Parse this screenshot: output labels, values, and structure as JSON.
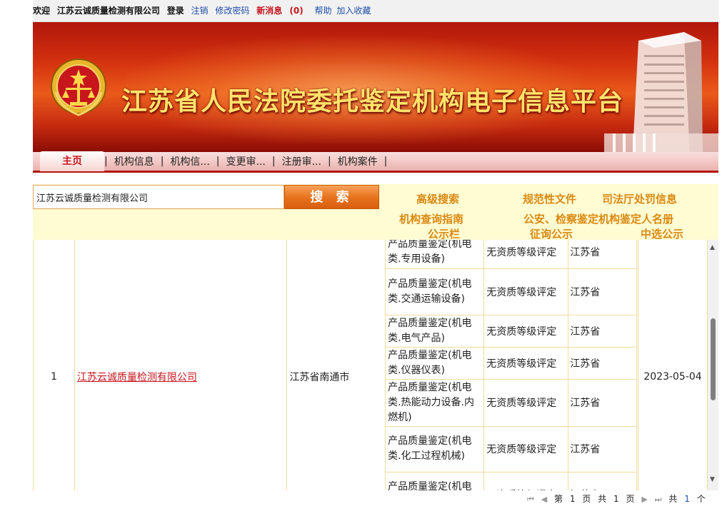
{
  "topbar": {
    "welcome": "欢迎",
    "company": "江苏云诚质量检测有限公司",
    "login": "登录",
    "logout": "注销",
    "change_password": "修改密码",
    "new_messages": "新消息",
    "message_count": "(0)",
    "help": "帮助",
    "favorite": "加入收藏"
  },
  "banner": {
    "title": "江苏省人民法院委托鉴定机构电子信息平台"
  },
  "nav": {
    "items": [
      "主页",
      "机构信息",
      "机构信...",
      "变更审...",
      "注册审...",
      "机构案件"
    ],
    "separator": "|"
  },
  "search": {
    "value": "江苏云诚质量检测有限公司",
    "button": "搜 索",
    "links": {
      "advanced": "高级搜索",
      "normative": "规范性文件",
      "penalty": "司法厅处罚信息",
      "guide": "机构查询指南",
      "roster": "公安、检察鉴定机构鉴定人名册",
      "bulletin": "公示栏",
      "solicit": "征询公示",
      "selected": "中选公示"
    }
  },
  "table": {
    "index": "1",
    "company": "江苏云诚质量检测有限公司",
    "city": "江苏省南通市",
    "date": "2023-05-04",
    "rows": [
      {
        "type": "产品质量鉴定(机电类.专用设备)",
        "level": "无资质等级评定",
        "region": "江苏省"
      },
      {
        "type": "产品质量鉴定(机电类.交通运输设备)",
        "level": "无资质等级评定",
        "region": "江苏省"
      },
      {
        "type": "产品质量鉴定(机电类.电气产品)",
        "level": "无资质等级评定",
        "region": "江苏省"
      },
      {
        "type": "产品质量鉴定(机电类.仪器仪表)",
        "level": "无资质等级评定",
        "region": "江苏省"
      },
      {
        "type": "产品质量鉴定(机电类.热能动力设备.内燃机)",
        "level": "无资质等级评定",
        "region": "江苏省"
      },
      {
        "type": "产品质量鉴定(机电类.化工过程机械)",
        "level": "无资质等级评定",
        "region": "江苏省"
      },
      {
        "type": "产品质量鉴定(机电类.化工过程设备)",
        "level": "无资质等级评定",
        "region": "江苏省"
      }
    ]
  },
  "pager": {
    "first_icon": "first-page-icon",
    "prev_icon": "prev-page-icon",
    "next_icon": "next-page-icon",
    "last_icon": "last-page-icon",
    "page_prefix": "第",
    "page": "1",
    "page_suffix": "页",
    "total_prefix": "共",
    "total_pages": "1",
    "total_pages_suffix": "页",
    "count_prefix": "共",
    "count": "1",
    "count_suffix": "个"
  },
  "colors": {
    "brand_red": "#c8161d",
    "link_blue": "#1f4fa8",
    "search_orange": "#e8741f",
    "link_gold": "#d98913",
    "panel_yellow": "#fffbd2"
  }
}
